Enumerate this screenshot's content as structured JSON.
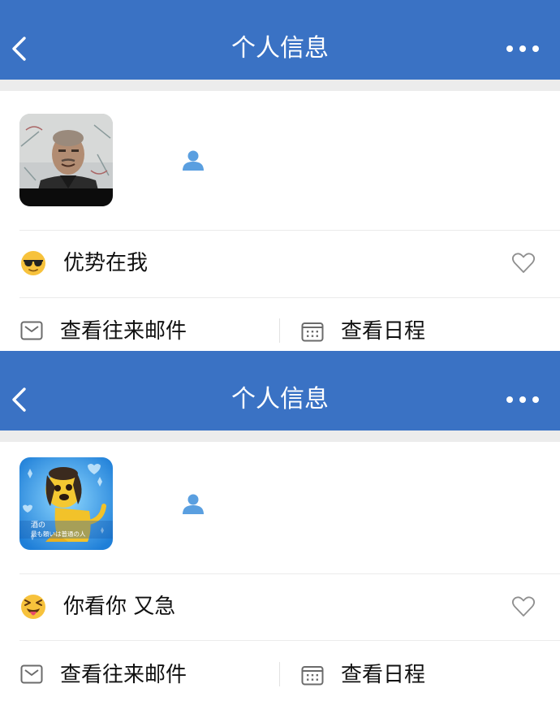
{
  "colors": {
    "nav_bar": "#3a72c4",
    "contact_icon": "#5a9fe0",
    "icon_gray": "#6b6b6b"
  },
  "panels": [
    {
      "header": {
        "back_icon": "chevron-left-icon",
        "title": "个人信息",
        "more_icon": "more-dots-icon"
      },
      "profile": {
        "avatar": "portrait-photo",
        "contact_icon": "person-icon"
      },
      "status": {
        "emoji": "sunglasses-emoji",
        "text": "优势在我",
        "like_icon": "heart-outline-icon"
      },
      "actions": [
        {
          "icon": "mail-icon",
          "label": "查看往来邮件"
        },
        {
          "icon": "calendar-icon",
          "label": "查看日程"
        }
      ]
    },
    {
      "header": {
        "back_icon": "chevron-left-icon",
        "title": "个人信息",
        "more_icon": "more-dots-icon"
      },
      "profile": {
        "avatar": "cartoon-dog-image",
        "avatar_caption": [
          "酒の",
          "最も頼いは普通の人"
        ],
        "contact_icon": "person-icon"
      },
      "status": {
        "emoji": "squinting-tongue-emoji",
        "text": "你看你 又急",
        "like_icon": "heart-outline-icon"
      },
      "actions": [
        {
          "icon": "mail-icon",
          "label": "查看往来邮件"
        },
        {
          "icon": "calendar-icon",
          "label": "查看日程"
        }
      ]
    }
  ]
}
